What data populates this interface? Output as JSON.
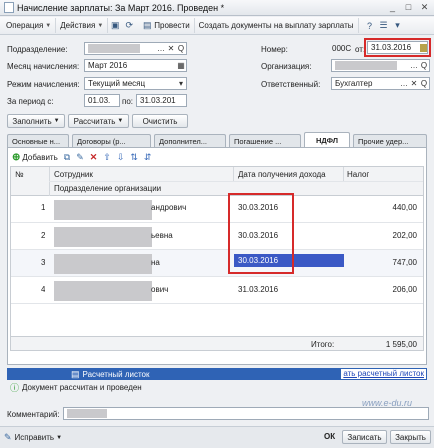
{
  "window": {
    "title": "Начисление зарплаты: За Март 2016. Проведен *"
  },
  "toolbar": {
    "operation": "Операция",
    "actions": "Действия",
    "post": "Провести",
    "create_docs": "Создать документы на выплату зарплаты"
  },
  "form": {
    "department_label": "Подразделение:",
    "month_label": "Месяц начисления:",
    "month_value": "Март 2016",
    "mode_label": "Режим начисления:",
    "mode_value": "Текущий месяц",
    "period_label": "За период с:",
    "period_from": "01.03.",
    "period_to_label": "по:",
    "period_to": "31.03.201",
    "number_label": "Номер:",
    "number_value": "000С",
    "date_label": "от:",
    "date_value": "31.03.2016",
    "org_label": "Организация:",
    "resp_label": "Ответственный:",
    "resp_value": "Бухгалтер"
  },
  "actions_row": {
    "fill": "Заполнить",
    "calculate": "Рассчитать",
    "clear": "Очистить"
  },
  "tabs": [
    {
      "label": "Основные н..."
    },
    {
      "label": "Договоры (р..."
    },
    {
      "label": "Дополнител..."
    },
    {
      "label": "Погашение ..."
    },
    {
      "label": "НДФЛ"
    },
    {
      "label": "Прочие удер..."
    }
  ],
  "grid_toolbar": {
    "add": "Добавить"
  },
  "grid": {
    "col_num": "№",
    "col_employee": "Сотрудник",
    "col_employee_sub": "Подразделение организации",
    "col_date": "Дата получения дохода",
    "col_amount": "Налог",
    "rows": [
      {
        "num": "1",
        "employee_tail": "андрович",
        "date": "30.03.2016",
        "amount": "440,00"
      },
      {
        "num": "2",
        "employee_tail": "ьевна",
        "date": "30.03.2016",
        "amount": "202,00"
      },
      {
        "num": "3",
        "employee_tail": "на",
        "date": "30.03.2016",
        "amount": "747,00"
      },
      {
        "num": "4",
        "employee_tail": "ович",
        "date": "31.03.2016",
        "amount": "206,00"
      }
    ],
    "total_label": "Итого:",
    "total_value": "1 595,00"
  },
  "status": {
    "payslip": "Расчетный листок",
    "payslip_link": "ать расчетный листок",
    "doc_status": "Документ рассчитан и проведен"
  },
  "comment_label": "Комментарий:",
  "footer": {
    "fix": "Исправить",
    "ok": "ОК",
    "save": "Записать",
    "close": "Закрыть"
  },
  "watermark": "www.e-du.ru"
}
